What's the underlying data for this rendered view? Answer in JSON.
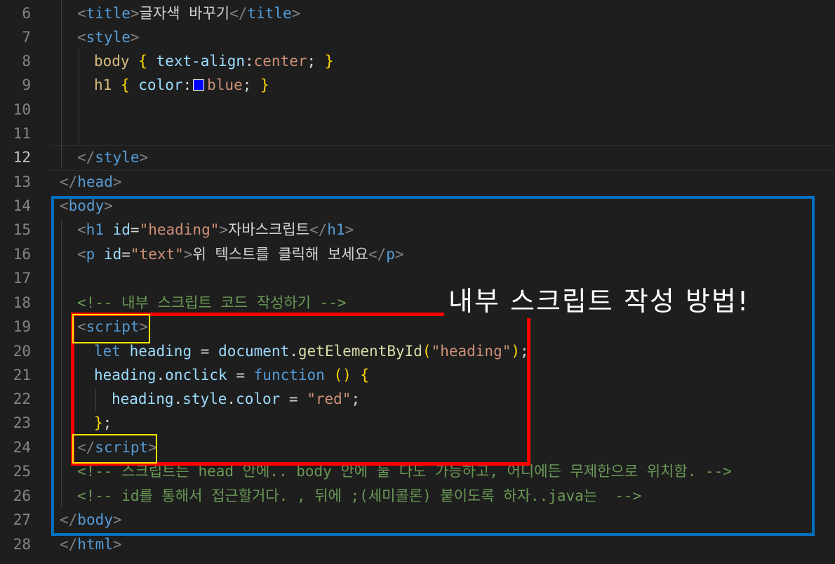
{
  "line_numbers": [
    "6",
    "7",
    "8",
    "9",
    "10",
    "11",
    "12",
    "13",
    "14",
    "15",
    "16",
    "17",
    "18",
    "19",
    "20",
    "21",
    "22",
    "23",
    "24",
    "25",
    "26",
    "27",
    "28"
  ],
  "active_line": "12",
  "swatch_color": "#0000ff",
  "annotation": "내부 스크립트 작성 방법!",
  "code": {
    "l6_title_text": "글자색 바꾸기",
    "l8_prop": "text-align",
    "l8_value": "center",
    "l9_prop": "color",
    "l9_value": "blue",
    "l15_id": "\"heading\"",
    "l15_text": "자바스크립트",
    "l16_id": "\"text\"",
    "l16_text": "위 텍스트를 클릭해 보세요",
    "l18_comment": "<!-- 내부 스크립트 코드 작성하기 -->",
    "l20_arg": "\"heading\"",
    "l22_value": "\"red\"",
    "l25_comment": "<!-- 스크립트는 head 안에.. body 안에 둘 다도 가능하고, 어디에든 무제한으로 위치함. -->",
    "l26_comment": "<!-- id를 통해서 접근할거다. , 뒤에 ;(세미콜론) 붙이도록 하자..java는  -->"
  }
}
